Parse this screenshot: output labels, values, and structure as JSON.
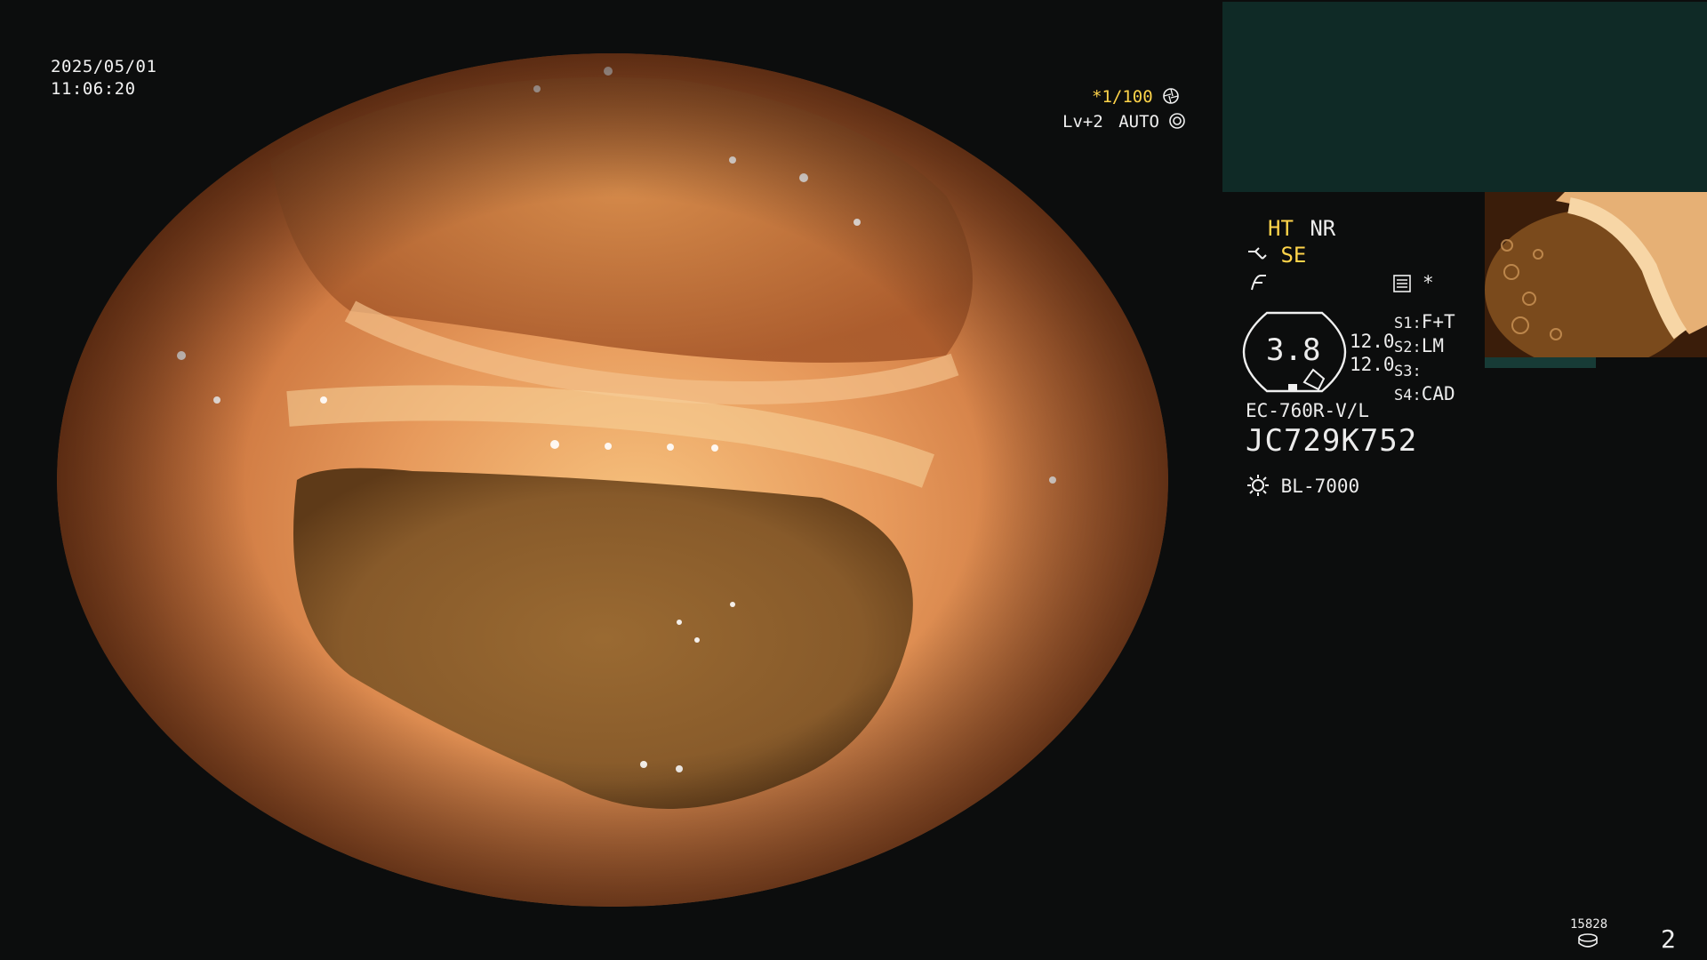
{
  "header": {
    "date": "2025/05/01",
    "time": "11:06:20"
  },
  "overlay": {
    "shutter": "*1/100",
    "shutter_icon": "aperture-icon",
    "level": "Lv+2",
    "mode": "AUTO",
    "mode_icon": "iris-icon"
  },
  "panel": {
    "ht": "HT",
    "nr": "NR",
    "se": "SE",
    "magnify_value": "3.8",
    "val1": "12.0",
    "val2": "12.0",
    "s1_label": "S1:",
    "s1_value": "F+T",
    "s2_label": "S2:",
    "s2_value": "LM",
    "s3_label": "S3:",
    "s3_value": "",
    "s4_label": "S4:",
    "s4_value": "CAD",
    "scope_model": "EC-760R-V/L",
    "scope_serial": "JC729K752",
    "light_source": "BL-7000",
    "star": "*"
  },
  "footer": {
    "counter": "15828",
    "page": "2"
  },
  "colors": {
    "accent_yellow": "#ffd44a",
    "pip_bg": "#0f2a26",
    "background": "#0c0d0d"
  },
  "icons": [
    "aperture-icon",
    "iris-icon",
    "scope-icon",
    "noise-icon",
    "memory-icon",
    "magnification-gauge-icon",
    "light-source-icon",
    "disk-icon"
  ]
}
